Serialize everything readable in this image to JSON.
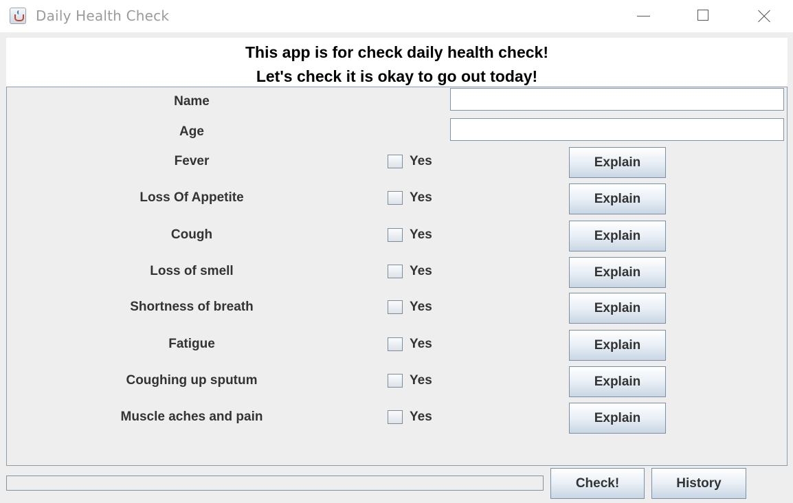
{
  "window": {
    "title": "Daily Health Check",
    "icon": "java-cup-icon",
    "controls": [
      "minimize-icon",
      "maximize-icon",
      "close-icon"
    ]
  },
  "header": {
    "line1": "This app is for check daily health check!",
    "line2": "Let's check it is okay to go out today!"
  },
  "fields": {
    "name": {
      "label": "Name",
      "value": ""
    },
    "age": {
      "label": "Age",
      "value": ""
    }
  },
  "symptoms": [
    {
      "label": "Fever",
      "checkbox_label": "Yes",
      "checked": false,
      "button_label": "Explain"
    },
    {
      "label": "Loss Of Appetite",
      "checkbox_label": "Yes",
      "checked": false,
      "button_label": "Explain"
    },
    {
      "label": "Cough",
      "checkbox_label": "Yes",
      "checked": false,
      "button_label": "Explain"
    },
    {
      "label": "Loss of smell",
      "checkbox_label": "Yes",
      "checked": false,
      "button_label": "Explain"
    },
    {
      "label": "Shortness of breath",
      "checkbox_label": "Yes",
      "checked": false,
      "button_label": "Explain"
    },
    {
      "label": "Fatigue",
      "checkbox_label": "Yes",
      "checked": false,
      "button_label": "Explain"
    },
    {
      "label": "Coughing up sputum",
      "checkbox_label": "Yes",
      "checked": false,
      "button_label": "Explain"
    },
    {
      "label": "Muscle aches and pain",
      "checkbox_label": "Yes",
      "checked": false,
      "button_label": "Explain"
    }
  ],
  "footer": {
    "progress": 0,
    "check_label": "Check!",
    "history_label": "History"
  }
}
